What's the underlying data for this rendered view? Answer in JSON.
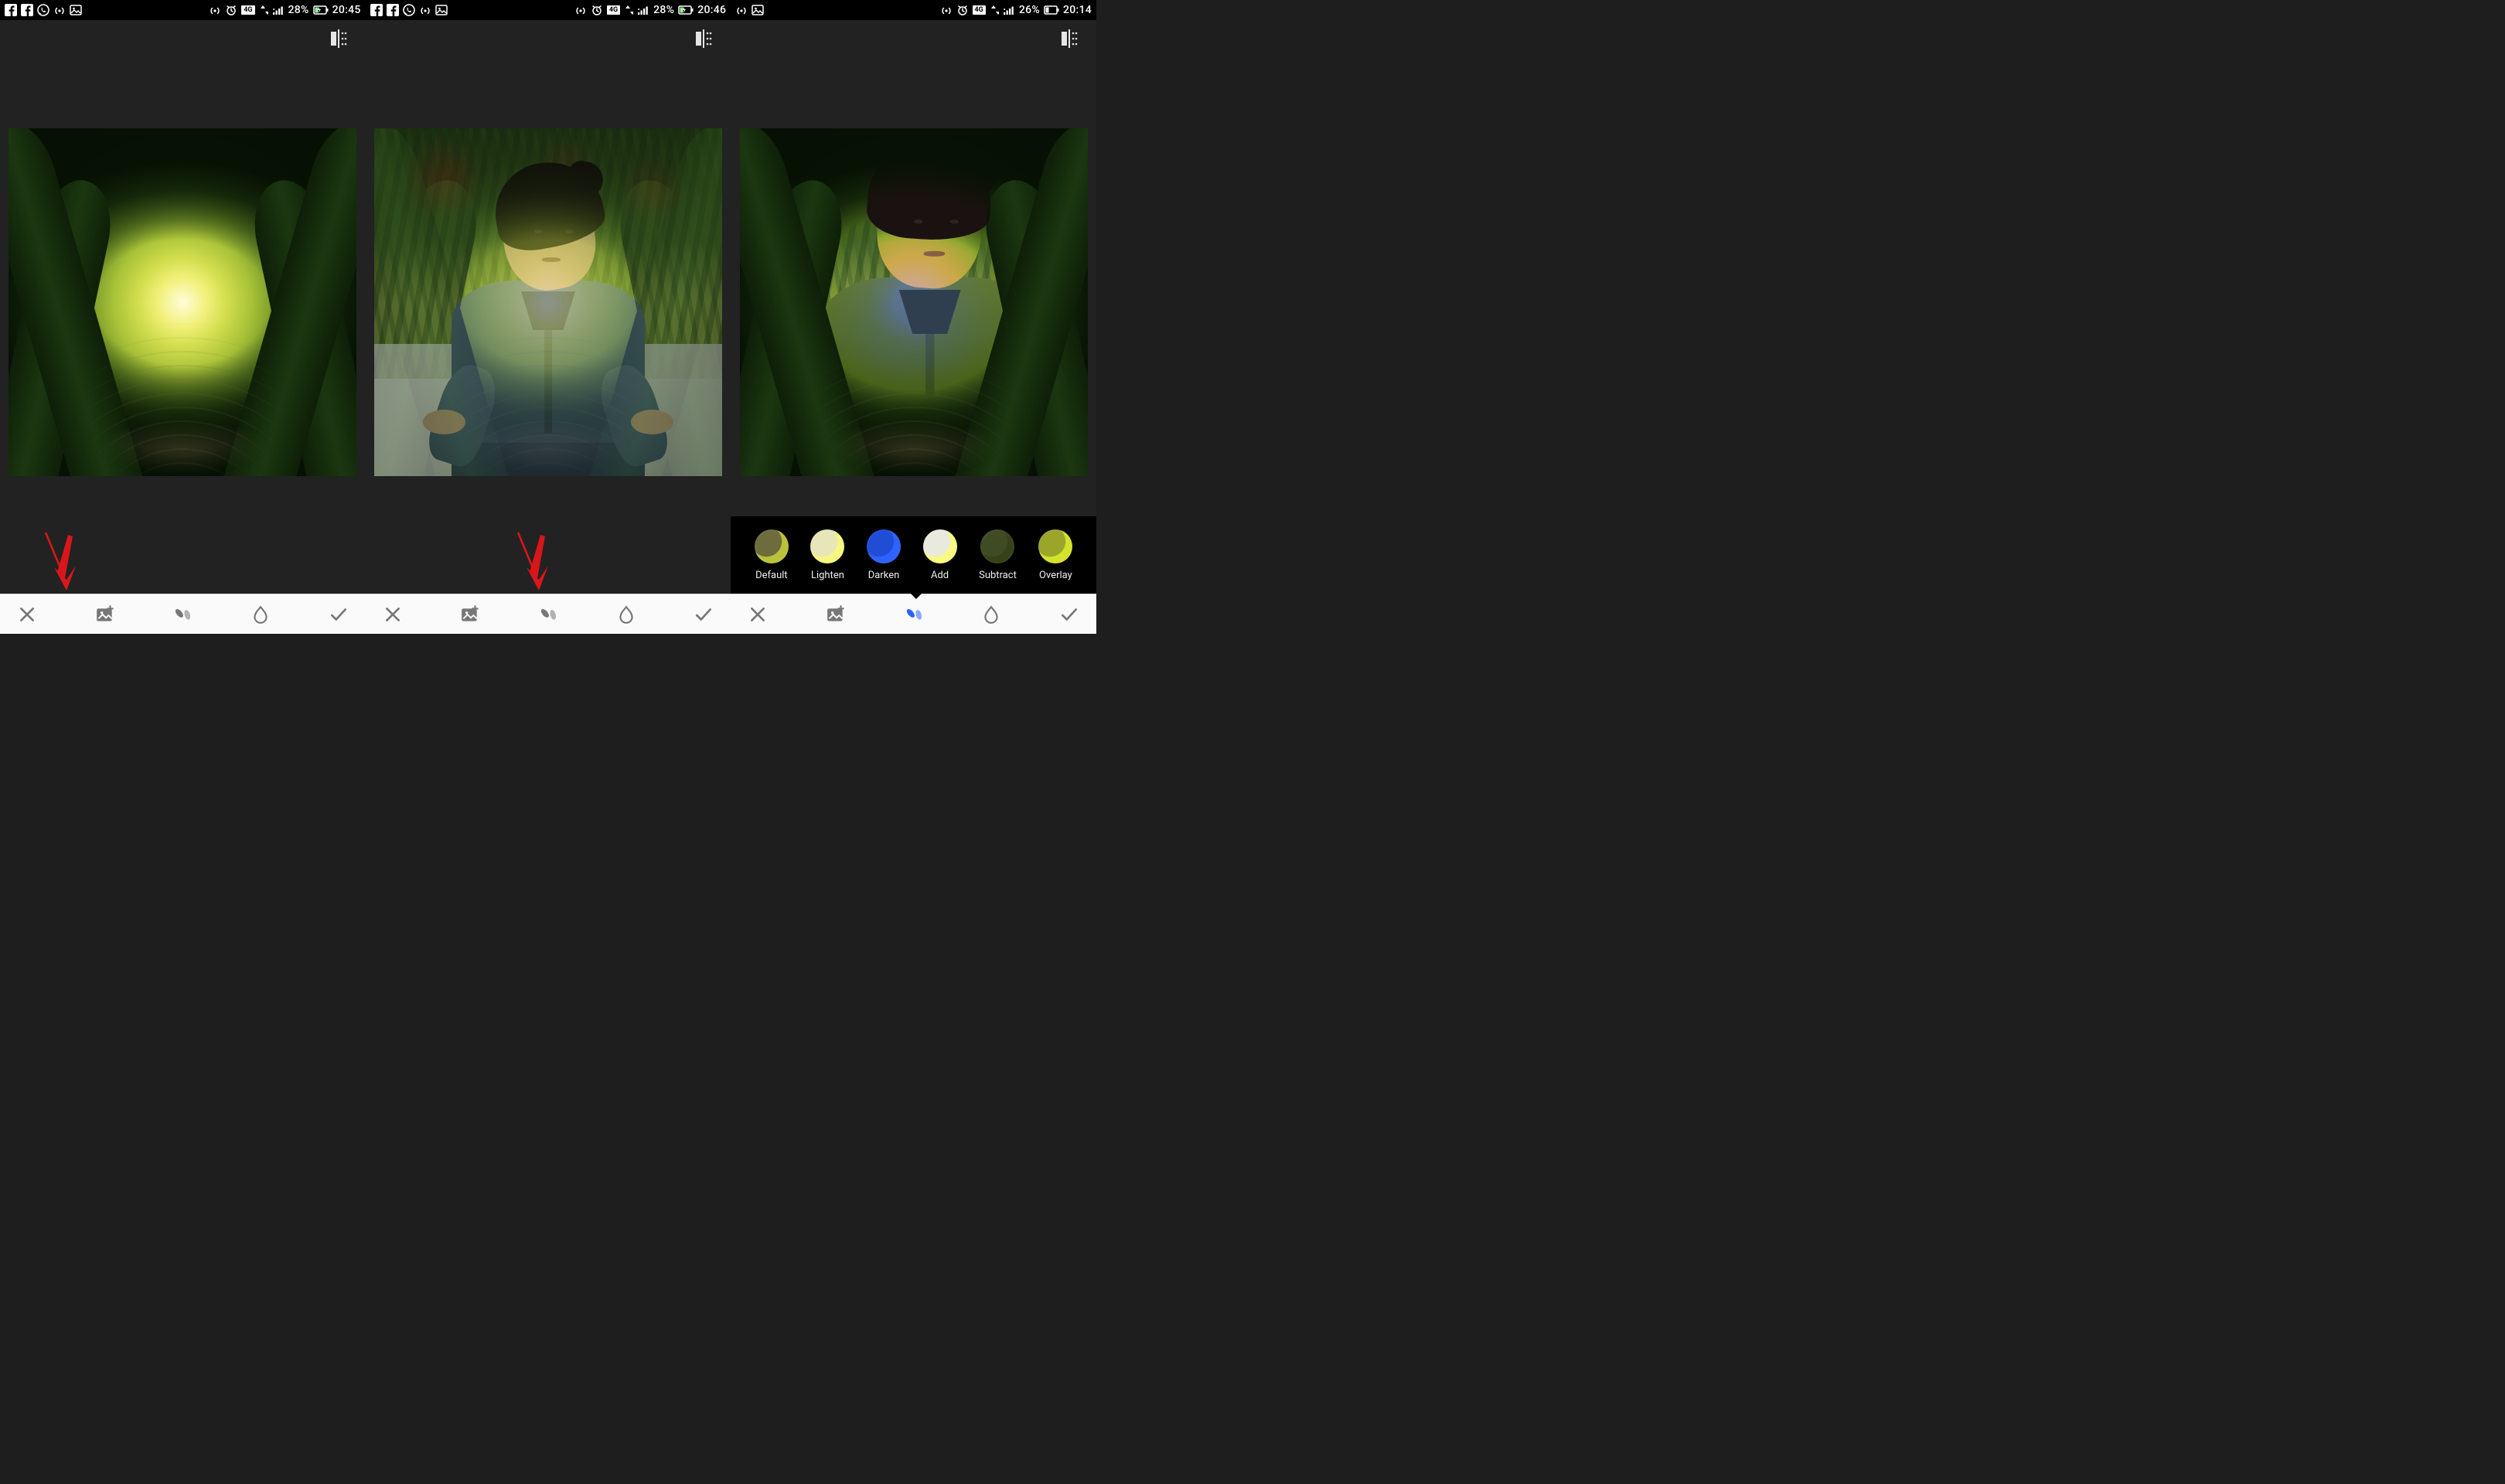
{
  "screens": [
    {
      "status": {
        "battery_text": "28%",
        "time": "20:45",
        "network_badge": "4G"
      },
      "blend_panel_visible": false,
      "annotation_arrow": true,
      "arrow_target": "add-image-button",
      "toolbar_active": null
    },
    {
      "status": {
        "battery_text": "28%",
        "time": "20:46",
        "network_badge": "4G"
      },
      "blend_panel_visible": false,
      "annotation_arrow": true,
      "arrow_target": "blend-mode-button",
      "toolbar_active": null
    },
    {
      "status": {
        "battery_text": "26%",
        "time": "20:14",
        "network_badge": "4G"
      },
      "blend_panel_visible": true,
      "annotation_arrow": false,
      "toolbar_active": "blend-mode-button",
      "blend_modes": [
        {
          "label": "Default",
          "swatch_a": "#6d6c3c",
          "swatch_b": "#bac23a"
        },
        {
          "label": "Lighten",
          "swatch_a": "#e6e6b9",
          "swatch_b": "#f6f680"
        },
        {
          "label": "Darken",
          "swatch_a": "#1f4dd6",
          "swatch_b": "#2e62ff"
        },
        {
          "label": "Add",
          "swatch_a": "#e9eadd",
          "swatch_b": "#f8fa7f"
        },
        {
          "label": "Subtract",
          "swatch_a": "#3f4b23",
          "swatch_b": "#364117"
        },
        {
          "label": "Overlay",
          "swatch_a": "#9aa52a",
          "swatch_b": "#d5e22d"
        }
      ],
      "blend_selected_index": 2
    }
  ],
  "toolbar_icons": [
    "cancel",
    "add-image",
    "blend-mode",
    "opacity",
    "confirm"
  ]
}
